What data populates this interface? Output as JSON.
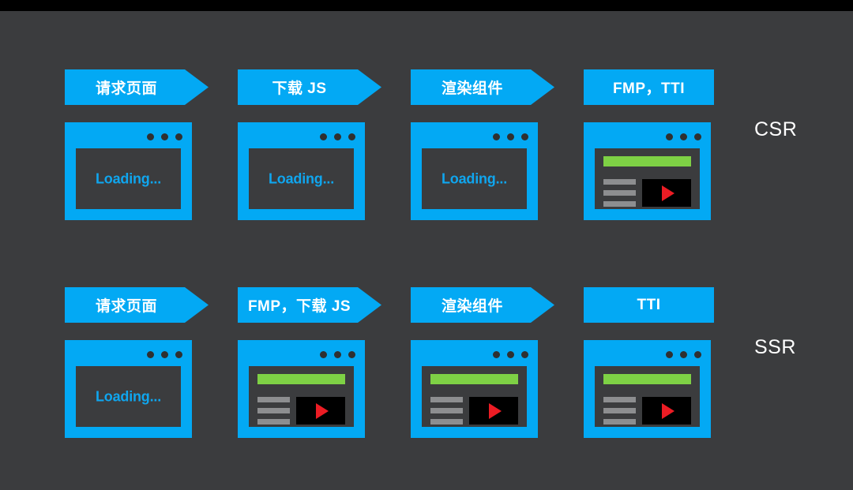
{
  "slide": {
    "background_color": "#3b3c3e",
    "accent_blue": "#03a9f4",
    "green": "#7ed145",
    "red": "#ec1c24",
    "gray_line": "#8d8e90",
    "loading_text_color": "#0fa6ef",
    "top_bar_color": "#000000"
  },
  "rows": [
    {
      "label": "CSR",
      "stages": [
        {
          "banner_label": "请求页面",
          "banner_shape": "arrow",
          "browser_state": "loading",
          "loading_text": "Loading..."
        },
        {
          "banner_label": "下载 JS",
          "banner_shape": "arrow",
          "browser_state": "loading",
          "loading_text": "Loading..."
        },
        {
          "banner_label": "渲染组件",
          "banner_shape": "arrow",
          "browser_state": "loading",
          "loading_text": "Loading..."
        },
        {
          "banner_label": "FMP，TTI",
          "banner_shape": "flat",
          "browser_state": "loaded",
          "loading_text": ""
        }
      ]
    },
    {
      "label": "SSR",
      "stages": [
        {
          "banner_label": "请求页面",
          "banner_shape": "arrow",
          "browser_state": "loading",
          "loading_text": "Loading..."
        },
        {
          "banner_label": "FMP，下载 JS",
          "banner_shape": "arrow",
          "browser_state": "loaded",
          "loading_text": ""
        },
        {
          "banner_label": "渲染组件",
          "banner_shape": "arrow",
          "browser_state": "loaded",
          "loading_text": ""
        },
        {
          "banner_label": "TTI",
          "banner_shape": "flat",
          "browser_state": "loaded",
          "loading_text": ""
        }
      ]
    }
  ]
}
